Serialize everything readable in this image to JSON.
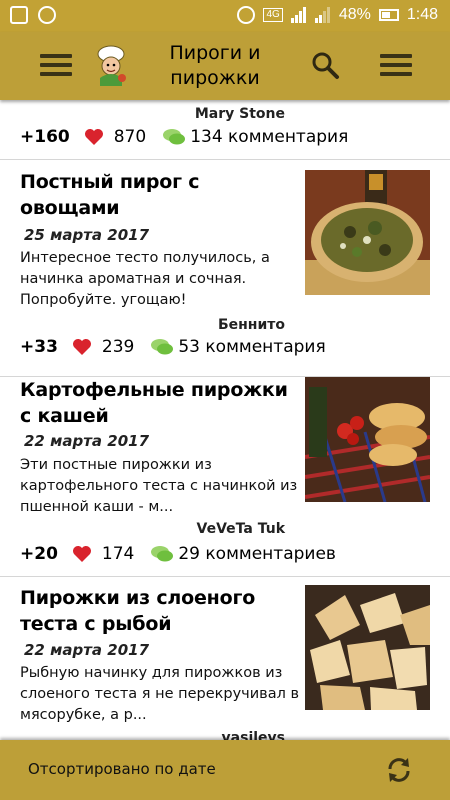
{
  "status_bar": {
    "network": "4G",
    "battery": "48%",
    "time": "1:48"
  },
  "app_bar": {
    "title": "Пироги и пирожки"
  },
  "top_entry": {
    "author": "Mary Stone",
    "score": "+160",
    "likes": "870",
    "comments": "134 комментария"
  },
  "recipes": [
    {
      "title": "Постный пирог с овощами",
      "date": "25 марта 2017",
      "description": "Интересное тесто получилось, а начинка ароматная и сочная. Попробуйте. угощаю!",
      "author": "Беннито",
      "score": "+33",
      "likes": "239",
      "comments": "53 комментария"
    },
    {
      "title": "Картофельные пирожки с кашей",
      "date": "22 марта 2017",
      "description": "Эти постные пирожки из картофельного теста с начинкой из пшенной каши - м...",
      "author": "VeVeTa Tuk",
      "score": "+20",
      "likes": "174",
      "comments": "29 комментариев"
    },
    {
      "title": "Пирожки из слоеного теста с рыбой",
      "date": "22 марта 2017",
      "description": "Рыбную начинку для пирожков из слоеного теста я не перекручивал в мясорубке, а р...",
      "author": "vasilevs"
    }
  ],
  "bottom_bar": {
    "sort_label": "Отсортировано по дате"
  },
  "colors": {
    "bar": "#bd9f38",
    "status_bar": "#c2a235",
    "heart": "#d9232d",
    "bubble": "#7ec84a"
  }
}
